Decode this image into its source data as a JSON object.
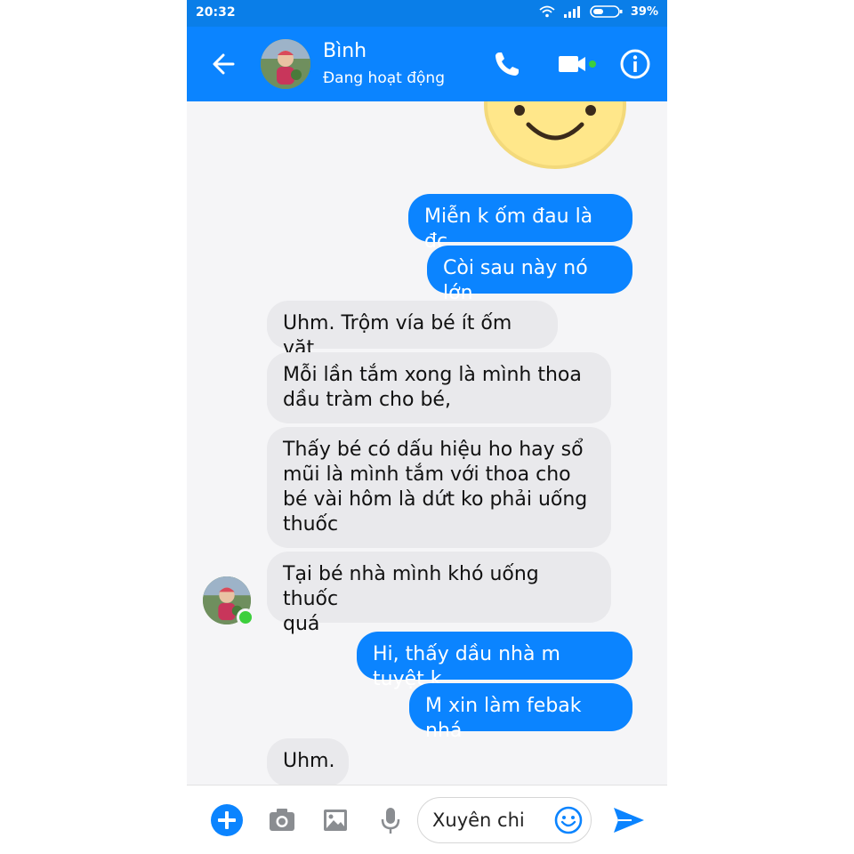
{
  "status_bar": {
    "time": "20:32",
    "battery": "39%"
  },
  "header": {
    "name": "Bình",
    "status": "Đang hoạt động"
  },
  "messages": [
    {
      "sender": "me",
      "text": "Miễn k ốm đau là đc"
    },
    {
      "sender": "me",
      "text": "Còi sau này nó lớn"
    },
    {
      "sender": "contact",
      "text": "Uhm.  Trộm vía bé ít ốm vặt"
    },
    {
      "sender": "contact",
      "line1": "Mỗi lần  tắm xong là mình thoa",
      "line2": "dầu tràm cho bé,"
    },
    {
      "sender": "contact",
      "line1": "Thấy bé  có  dấu hiệu ho hay sổ",
      "line2": "mũi  là  mình tắm với  thoa cho",
      "line3": "bé vài hôm là  dứt  ko phải  uống",
      "line4": "thuốc"
    },
    {
      "sender": "contact",
      "line1": "Tại bé  nhà  mình khó uống thuốc",
      "line2": "quá"
    },
    {
      "sender": "me",
      "text": "Hi, thấy dầu nhà m tuyệt k"
    },
    {
      "sender": "me",
      "text": "M xin làm febak nhá"
    },
    {
      "sender": "contact",
      "text": "Uhm."
    }
  ],
  "composer": {
    "input_value": "Xuyên chi"
  },
  "colors": {
    "brand_blue": "#0b84ff",
    "status_bar": "#0a7ee8",
    "incoming_bubble": "#e9e9ec",
    "online": "#3ccf3c"
  },
  "icons": [
    "back-arrow-icon",
    "phone-icon",
    "video-camera-icon",
    "info-icon",
    "plus-icon",
    "camera-icon",
    "image-icon",
    "microphone-icon",
    "emoji-icon",
    "send-icon",
    "wifi-icon",
    "signal-icon",
    "battery-icon"
  ]
}
